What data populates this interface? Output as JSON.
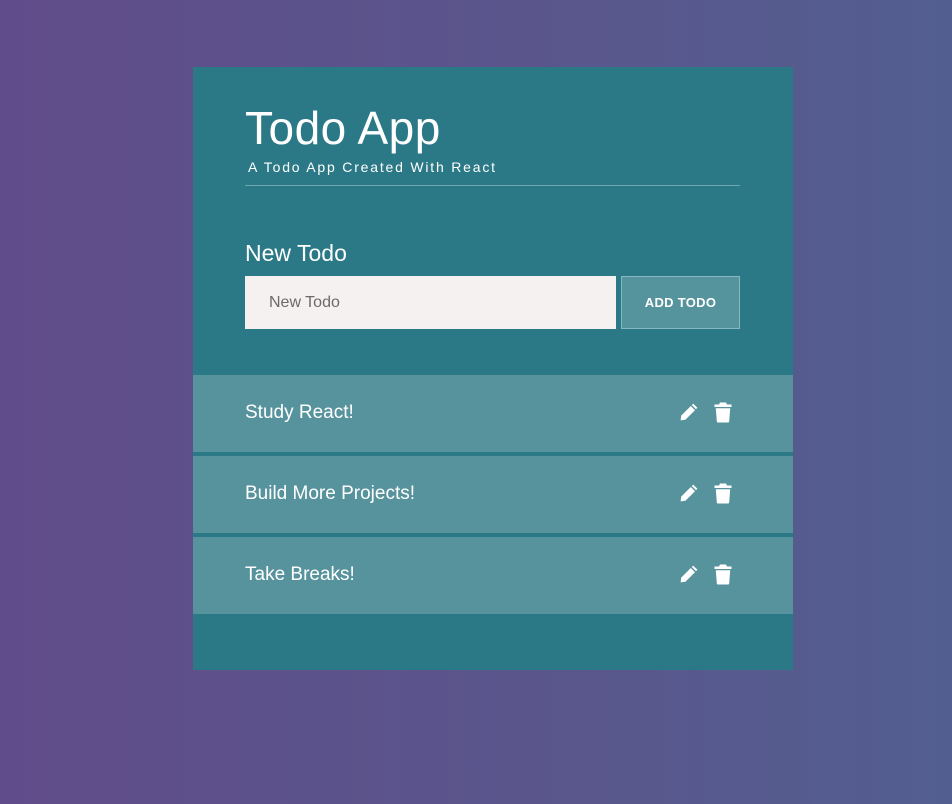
{
  "app": {
    "title": "Todo App",
    "subtitle": "A Todo App Created With React"
  },
  "form": {
    "label": "New Todo",
    "input_placeholder": "New Todo",
    "input_value": "",
    "add_button_label": "ADD TODO"
  },
  "todos": [
    {
      "text": "Study React!"
    },
    {
      "text": "Build More Projects!"
    },
    {
      "text": "Take Breaks!"
    }
  ],
  "icons": {
    "edit": "pencil-icon",
    "delete": "trash-icon"
  },
  "colors": {
    "background_left": "#604c8a",
    "background_right": "#535e90",
    "card": "#2b7986",
    "todo_item": "#57939c",
    "input": "#f6f1f1",
    "text": "#ffffff"
  }
}
